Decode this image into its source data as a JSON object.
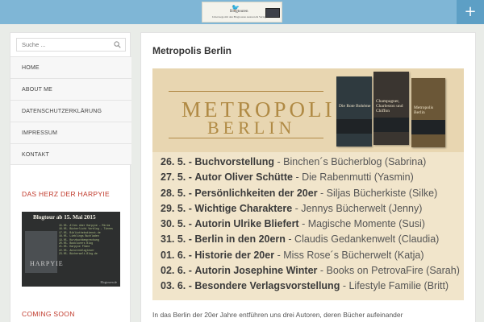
{
  "header": {
    "logo": {
      "name": "Blogtouren",
      "tagline": "Unterwegs mit den Blogtouren Autoren & Verlagsteam"
    },
    "plus_label": "+"
  },
  "sidebar": {
    "search": {
      "placeholder": "Suche ..."
    },
    "nav": [
      {
        "label": "HOME"
      },
      {
        "label": "ABOUT ME"
      },
      {
        "label": "DATENSCHUTZERKLÄRUNG"
      },
      {
        "label": "IMPRESSUM"
      },
      {
        "label": "KONTAKT"
      }
    ],
    "widget1_title": "DAS HERZ DER HARPYIE",
    "banner": {
      "title": "Blogtour ab 15. Mai 2015",
      "word": "HARPYIE",
      "footer": "Blogtouren.de",
      "lines": [
        "15.05. Alles über Harpyie – Mirim",
        "16.05. Bücherlicht Vorblog – Tinnes",
        "17.05. Bibliotheksdienst.de",
        "18.05. Lieblings Buchladen",
        "19.05. Kurzbuchbesprechung",
        "20.05. Booklovers Blog",
        "21.05. Harpyie Pläne",
        "22.05. Autorenblogleser",
        "23.05. Bücherwelt-Blog.de"
      ]
    },
    "widget2_title": "COMING SOON"
  },
  "post": {
    "title": "Metropolis Berlin",
    "hero_title_1": "METROPOLIS",
    "hero_title_2": "BERLIN",
    "books": [
      {
        "title": "Die Rote Bohème"
      },
      {
        "title": "Champagner, Charleston und Chiffon"
      },
      {
        "title": "Metropolis Berlin"
      }
    ],
    "schedule": [
      {
        "date": "26. 5. -",
        "event": "Buchvorstellung",
        "blog": "- Binchen´s Bücherblog (Sabrina)"
      },
      {
        "date": "27. 5. -",
        "event": "Autor Oliver Schütte",
        "blog": "- Die Rabenmutti (Yasmin)"
      },
      {
        "date": "28. 5. -",
        "event": "Persönlichkeiten der 20er",
        "blog": "- Siljas Bücherkiste (Silke)"
      },
      {
        "date": "29. 5. -",
        "event": "Wichtige Charaktere",
        "blog": "- Jennys Bücherwelt (Jenny)"
      },
      {
        "date": "30. 5. -",
        "event": "Autorin Ulrike Bliefert",
        "blog": "- Magische Momente (Susi)"
      },
      {
        "date": "31. 5. -",
        "event": "Berlin in den 20ern",
        "blog": "- Claudis Gedankenwelt (Claudia)"
      },
      {
        "date": "01. 6. -",
        "event": "Historie der 20er",
        "blog": "- Miss Rose´s Bücherwelt (Katja)"
      },
      {
        "date": "02. 6. -",
        "event": "Autorin Josephine Winter",
        "blog": "- Books on PetrovaFire (Sarah)"
      },
      {
        "date": "03. 6. -",
        "event": "Besondere Verlagsvorstellung",
        "blog": "- Lifestyle Familie (Britt)"
      }
    ],
    "intro": "In das Berlin der 20er Jahre entführen uns drei Autoren, deren Bücher aufeinander"
  }
}
